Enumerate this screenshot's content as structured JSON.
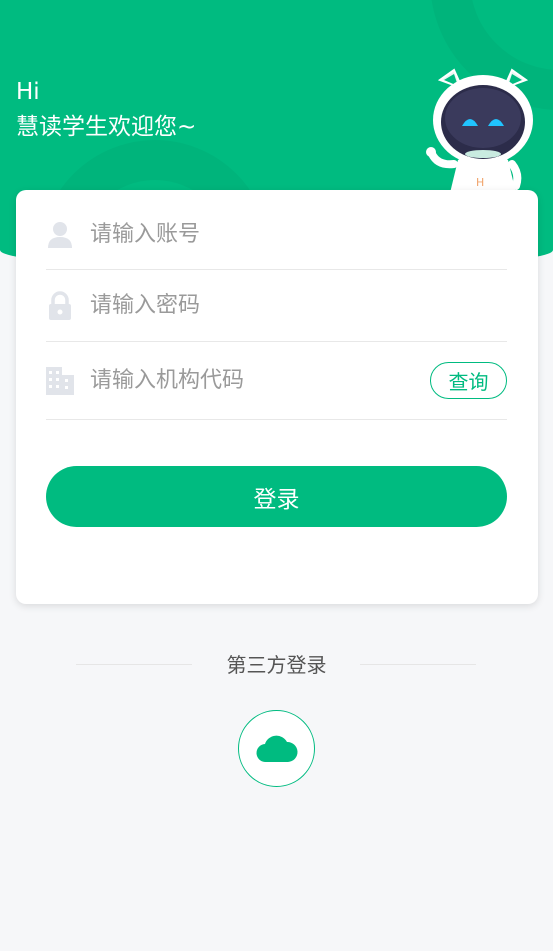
{
  "header": {
    "greeting": "Hi",
    "welcome": "慧读学生欢迎您~",
    "mascot_badge": "H"
  },
  "form": {
    "account_placeholder": "请输入账号",
    "password_placeholder": "请输入密码",
    "org_code_placeholder": "请输入机构代码",
    "query_label": "查询",
    "login_label": "登录"
  },
  "third_party": {
    "title": "第三方登录",
    "providers": [
      {
        "icon": "cloud-icon"
      }
    ]
  },
  "colors": {
    "brand": "#00bb80",
    "background": "#f6f7f9"
  }
}
